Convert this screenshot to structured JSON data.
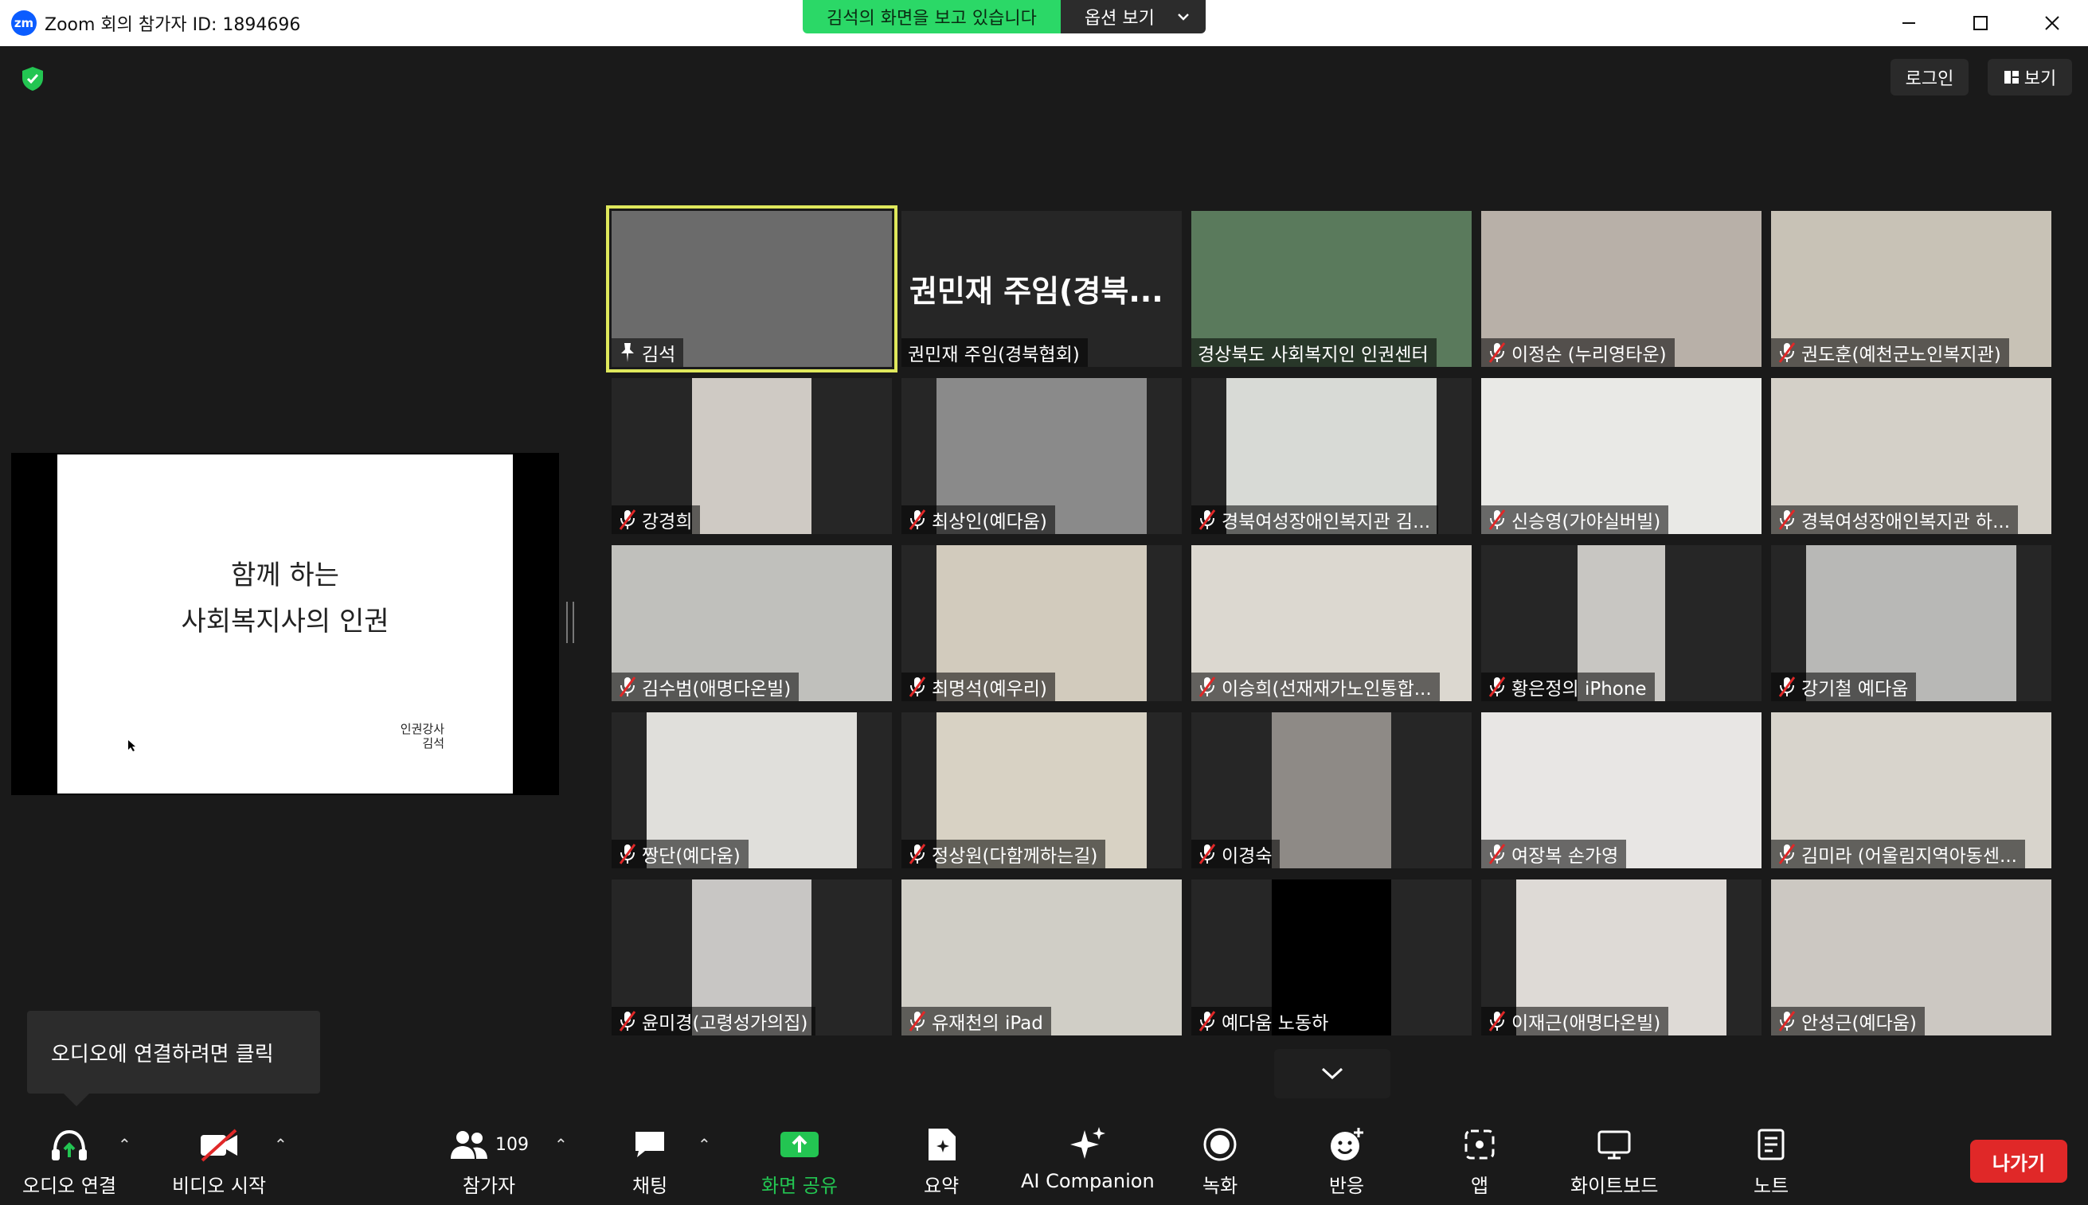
{
  "window": {
    "title": "Zoom 회의 참가자 ID: 1894696",
    "logo_text": "zm",
    "minimize_icon": "minimize-icon",
    "maximize_icon": "maximize-icon",
    "close_icon": "close-icon"
  },
  "share_banner": {
    "viewing_text": "김석의 화면을 보고 있습니다",
    "options_label": "옵션 보기",
    "color": "#2bd867"
  },
  "top_buttons": {
    "login": "로그인",
    "view": "보기"
  },
  "shared_slide": {
    "line1": "함께 하는",
    "line2": "사회복지사의 인권",
    "presenter_role": "인권강사",
    "presenter_name": "김석"
  },
  "participants": [
    {
      "name": "김석",
      "muted": false,
      "pinned": true,
      "active": true
    },
    {
      "name": "권민재 주임(경북협회)",
      "muted": false,
      "big_name": "권민재 주임(경북..."
    },
    {
      "name": "경상북도 사회복지인 인권센터",
      "muted": false
    },
    {
      "name": "이정순 (누리영타운)",
      "muted": true
    },
    {
      "name": "권도훈(예천군노인복지관)",
      "muted": true
    },
    {
      "name": "강경희",
      "muted": true
    },
    {
      "name": "최상인(예다움)",
      "muted": true
    },
    {
      "name": "경북여성장애인복지관 김...",
      "muted": true
    },
    {
      "name": "신승영(가야실버빌)",
      "muted": true
    },
    {
      "name": "경북여성장애인복지관 하...",
      "muted": true
    },
    {
      "name": "김수범(애명다온빌)",
      "muted": true
    },
    {
      "name": "최명석(예우리)",
      "muted": true
    },
    {
      "name": "이승희(선재재가노인통합...",
      "muted": true
    },
    {
      "name": "황은정의 iPhone",
      "muted": true
    },
    {
      "name": "강기철 예다움",
      "muted": true
    },
    {
      "name": "짱단(예다움)",
      "muted": true
    },
    {
      "name": "정상원(다함께하는길)",
      "muted": true
    },
    {
      "name": "이경숙",
      "muted": true
    },
    {
      "name": "여장복 손가영",
      "muted": true
    },
    {
      "name": "김미라 (어울림지역아동센...",
      "muted": true
    },
    {
      "name": "윤미경(고령성가의집)",
      "muted": true
    },
    {
      "name": "유재천의 iPad",
      "muted": true
    },
    {
      "name": "예다움 노동하",
      "muted": true
    },
    {
      "name": "이재근(애명다온빌)",
      "muted": true
    },
    {
      "name": "안성근(예다움)",
      "muted": true
    }
  ],
  "tooltip": {
    "text": "오디오에 연결하려면 클릭"
  },
  "toolbar": {
    "audio": "오디오 연결",
    "video": "비디오 시작",
    "participants": "참가자",
    "participants_count": "109",
    "chat": "채팅",
    "share": "화면 공유",
    "summary": "요약",
    "ai_companion": "AI Companion",
    "record": "녹화",
    "reactions": "반응",
    "apps": "앱",
    "whiteboard": "화이트보드",
    "notes": "노트",
    "leave": "나가기",
    "accent_green": "#23c552",
    "leave_red": "#e02828"
  }
}
